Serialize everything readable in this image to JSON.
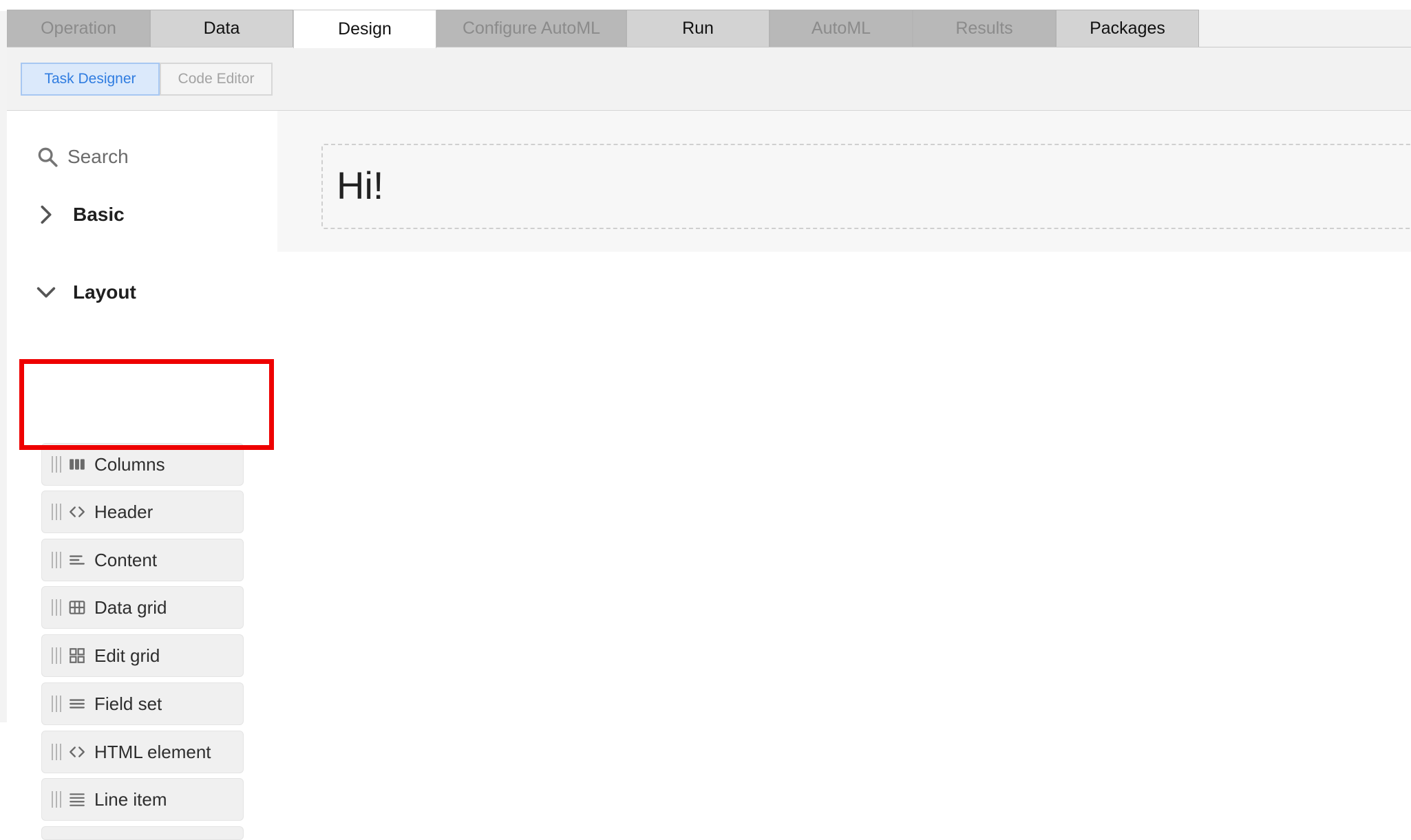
{
  "tabs": [
    {
      "label": "Operation",
      "state": "disabled"
    },
    {
      "label": "Data",
      "state": "enabled"
    },
    {
      "label": "Design",
      "state": "active"
    },
    {
      "label": "Configure AutoML",
      "state": "disabled"
    },
    {
      "label": "Run",
      "state": "enabled"
    },
    {
      "label": "AutoML",
      "state": "disabled"
    },
    {
      "label": "Results",
      "state": "disabled"
    },
    {
      "label": "Packages",
      "state": "enabled"
    }
  ],
  "subtabs": [
    {
      "label": "Task Designer",
      "selected": true
    },
    {
      "label": "Code Editor",
      "selected": false
    }
  ],
  "sidebar": {
    "search_placeholder": "Search",
    "sections": [
      {
        "label": "Basic",
        "expanded": false
      },
      {
        "label": "Layout",
        "expanded": true
      }
    ],
    "layout_components": [
      {
        "label": "Columns",
        "icon": "columns-icon"
      },
      {
        "label": "Header",
        "icon": "code-icon"
      },
      {
        "label": "Content",
        "icon": "text-lines-icon"
      },
      {
        "label": "Data grid",
        "icon": "table-icon"
      },
      {
        "label": "Edit grid",
        "icon": "grid-icon"
      },
      {
        "label": "Field set",
        "icon": "bars-icon"
      },
      {
        "label": "HTML element",
        "icon": "code-icon"
      },
      {
        "label": "Line item",
        "icon": "list-icon"
      }
    ]
  },
  "canvas": {
    "header_text": "Hi!"
  },
  "colors": {
    "highlight": "#ee0000",
    "accent": "#2f7ce0"
  }
}
